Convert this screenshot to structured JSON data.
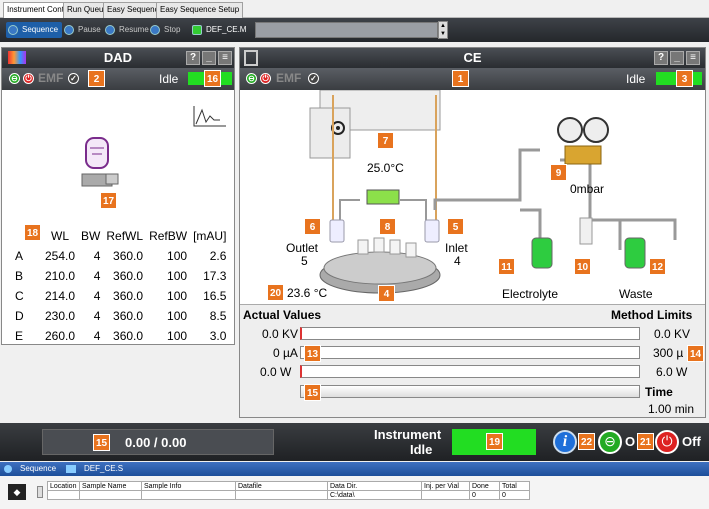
{
  "tabs": [
    "Instrument Control",
    "Run Queue",
    "Easy Sequence",
    "Easy Sequence Setup"
  ],
  "toolbar": {
    "sequence": "Sequence",
    "pause": "Pause",
    "resume": "Resume",
    "stop": "Stop",
    "method": "DEF_CE.M"
  },
  "dad": {
    "title": "DAD",
    "help": "?",
    "emf": "EMF",
    "status": "Idle",
    "badges": {
      "emf": "2",
      "status": "16",
      "lamp": "17",
      "table": "18"
    },
    "table": {
      "headers": [
        "WL",
        "BW",
        "RefWL",
        "RefBW",
        "[mAU]"
      ],
      "rows": [
        [
          "A",
          "254.0",
          "4",
          "360.0",
          "100",
          "2.6"
        ],
        [
          "B",
          "210.0",
          "4",
          "360.0",
          "100",
          "17.3"
        ],
        [
          "C",
          "214.0",
          "4",
          "360.0",
          "100",
          "16.5"
        ],
        [
          "D",
          "230.0",
          "4",
          "360.0",
          "100",
          "8.5"
        ],
        [
          "E",
          "260.0",
          "4",
          "360.0",
          "100",
          "3.0"
        ]
      ]
    }
  },
  "ce": {
    "title": "CE",
    "help": "?",
    "emf": "EMF",
    "status": "Idle",
    "badges": {
      "emf": "1",
      "status": "3",
      "temp": "7",
      "cassette": "8",
      "pressure": "9",
      "outlet": "6",
      "inlet": "5",
      "tray": "4",
      "elec": "11",
      "mid": "10",
      "waste": "12",
      "airtemp": "20",
      "voltage": "13",
      "progress": "15"
    },
    "cassette_temp": "25.0°C",
    "pressure": "0mbar",
    "outlet_label": "Outlet",
    "outlet_num": "5",
    "inlet_label": "Inlet",
    "inlet_num": "4",
    "air_temp": "23.6 °C",
    "electrolyte": "Electrolyte",
    "waste": "Waste",
    "actual_title": "Actual Values",
    "limits_title": "Method Limits",
    "actual": [
      "0.0 KV",
      "0 µA",
      "0.0 W"
    ],
    "limits": [
      "0.0 KV",
      "300 µ",
      "6.0 W"
    ],
    "limits_badge": "14",
    "time_label": "Time",
    "time_value": "1.00 min",
    "time_fill": 0
  },
  "bottom": {
    "progress": "0.00 / 0.00",
    "progress_badge": "15",
    "inst_label1": "Instrument",
    "inst_label2": "Idle",
    "inst_badge": "19",
    "info_badge": "22",
    "power_badge": "21",
    "on": "O",
    "off": "Off"
  },
  "seq": {
    "label": "Sequence",
    "file": "DEF_CE.S",
    "headers": [
      "Location",
      "Sample Name",
      "Sample Info",
      "Datafile",
      "Data Dir.",
      "Inj. per Vial",
      "Done",
      "Total"
    ],
    "row": [
      "",
      "",
      "",
      "",
      "C:\\data\\",
      "",
      "0",
      "0"
    ]
  },
  "colors": {
    "badge": "#e8731e",
    "idle": "#22dd22",
    "header": "#2a2d31",
    "seqbar": "#1d4f9a"
  }
}
